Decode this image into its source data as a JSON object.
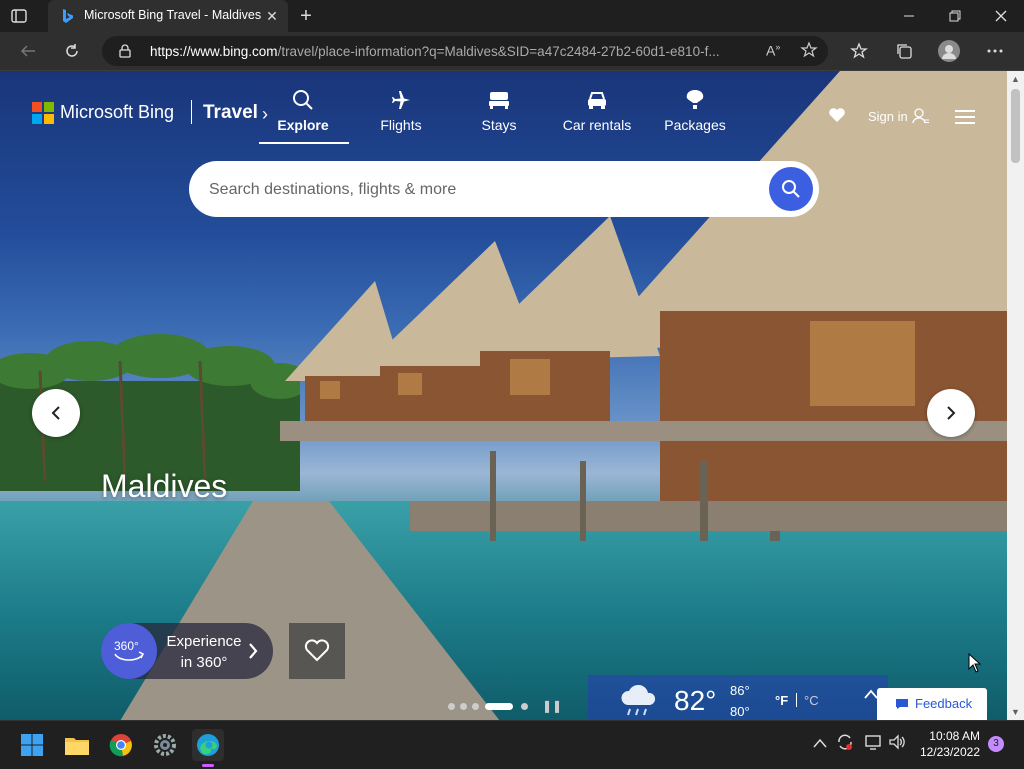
{
  "browser": {
    "tab_title": "Microsoft Bing Travel - Maldives",
    "url_host": "https://www.bing.com",
    "url_path": "/travel/place-information?q=Maldives&SID=a47c2484-27b2-60d1-e810-f..."
  },
  "header": {
    "brand": "Microsoft Bing",
    "section": "Travel",
    "nav": [
      {
        "label": "Explore",
        "icon": "search-icon"
      },
      {
        "label": "Flights",
        "icon": "plane-icon"
      },
      {
        "label": "Stays",
        "icon": "bed-icon"
      },
      {
        "label": "Car rentals",
        "icon": "car-icon"
      },
      {
        "label": "Packages",
        "icon": "balloon-icon"
      }
    ],
    "signin": "Sign in"
  },
  "search": {
    "placeholder": "Search destinations, flights & more"
  },
  "hero": {
    "title": "Maldives",
    "experience_label_1": "Experience",
    "experience_label_2": "in 360°",
    "badge_360": "360°"
  },
  "weather": {
    "temp": "82°",
    "high": "86°",
    "low": "80°",
    "unit_f": "°F",
    "unit_c": "°C"
  },
  "feedback": "Feedback",
  "taskbar": {
    "time": "10:08 AM",
    "date": "12/23/2022",
    "notifications": "3"
  },
  "colors": {
    "accent": "#3c5fe2",
    "brand_blue": "#4e5ed8"
  }
}
